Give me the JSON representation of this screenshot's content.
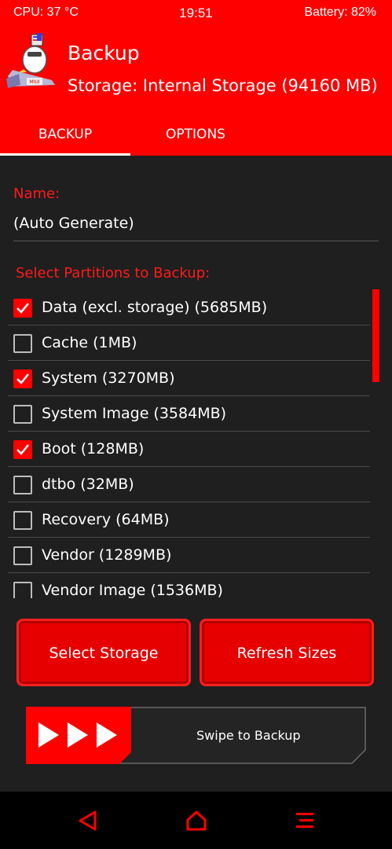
{
  "status_bar": {
    "cpu": "CPU: 37 °C",
    "time": "19:51",
    "battery": "Battery: 82%"
  },
  "header": {
    "title": "Backup",
    "storage": "Storage: Internal Storage (94160 MB)"
  },
  "tabs": [
    {
      "label": "BACKUP",
      "active": true
    },
    {
      "label": "OPTIONS",
      "active": false
    }
  ],
  "name_field": {
    "label": "Name:",
    "value": "(Auto Generate)"
  },
  "partitions": {
    "label": "Select Partitions to Backup:",
    "items": [
      {
        "label": "Data (excl. storage) (5685MB)",
        "checked": true
      },
      {
        "label": "Cache (1MB)",
        "checked": false
      },
      {
        "label": "System (3270MB)",
        "checked": true
      },
      {
        "label": "System Image (3584MB)",
        "checked": false
      },
      {
        "label": "Boot (128MB)",
        "checked": true
      },
      {
        "label": "dtbo (32MB)",
        "checked": false
      },
      {
        "label": "Recovery (64MB)",
        "checked": false
      },
      {
        "label": "Vendor (1289MB)",
        "checked": false
      },
      {
        "label": "Vendor Image (1536MB)",
        "checked": false
      }
    ]
  },
  "buttons": {
    "select_storage": "Select Storage",
    "refresh_sizes": "Refresh Sizes"
  },
  "swipe": {
    "label": "Swipe to Backup"
  },
  "colors": {
    "accent": "#ff0000",
    "background": "#1f1f1f",
    "navbar": "#000000"
  },
  "icons": {
    "logo": "twrp-logo",
    "back": "back-triangle-icon",
    "home": "home-icon",
    "menu": "menu-icon"
  }
}
